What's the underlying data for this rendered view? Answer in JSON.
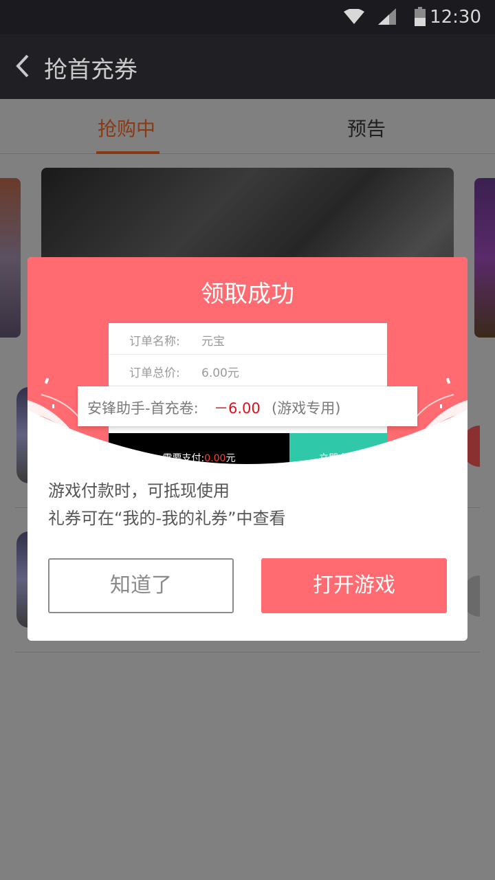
{
  "status_bar": {
    "time": "12:30"
  },
  "app_bar": {
    "title": "抢首充券"
  },
  "tabs": [
    {
      "label": "抢购中",
      "active": true
    },
    {
      "label": "预告",
      "active": false
    }
  ],
  "dialog": {
    "title": "领取成功",
    "receipt": {
      "rows": [
        {
          "label": "订单名称:",
          "value": "元宝"
        },
        {
          "label": "订单总价:",
          "value": "6.00元"
        }
      ],
      "pay_label": "需要支付:",
      "pay_amount": "0.00",
      "pay_unit": "元",
      "pay_button": "立即支付"
    },
    "coupon": {
      "name": "安锋助手-首充卷:",
      "amount": "－6.00",
      "note": "(游戏专用)"
    },
    "description": [
      "游戏付款时，可抵现使用",
      "礼券可在“我的-我的礼券”中查看"
    ],
    "buttons": {
      "dismiss": "知道了",
      "open_game": "打开游戏"
    }
  },
  "colors": {
    "accent": "#ff6b70",
    "coupon_amount": "#e0101a",
    "pay_button": "#2fc8a8",
    "tab_active": "#8a3a12"
  }
}
